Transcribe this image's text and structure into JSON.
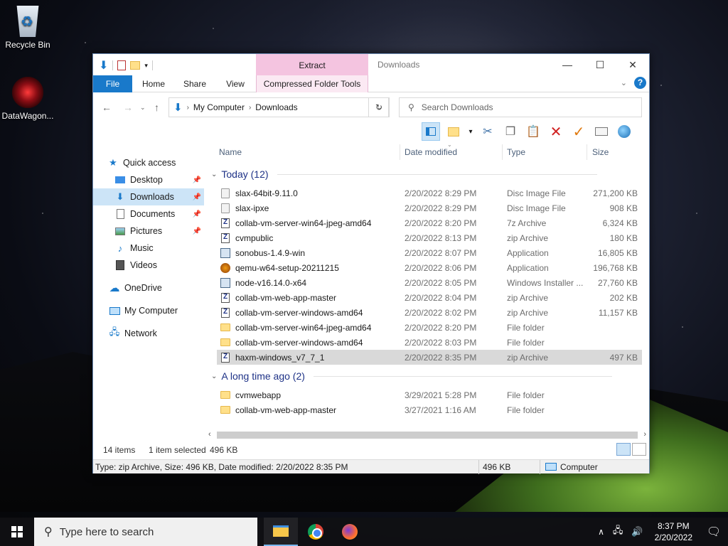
{
  "desktop": {
    "icons": [
      {
        "label": "Recycle Bin"
      },
      {
        "label": "DataWagon..."
      }
    ]
  },
  "window": {
    "title": "Downloads",
    "contextual_tab_group": "Extract",
    "ribbon_tabs": {
      "file": "File",
      "home": "Home",
      "share": "Share",
      "view": "View",
      "contextual": "Compressed Folder Tools"
    },
    "address": {
      "segments": [
        "My Computer",
        "Downloads"
      ]
    },
    "search": {
      "placeholder": "Search Downloads"
    },
    "nav_pane": [
      {
        "label": "Quick access",
        "icon": "star-icon"
      },
      {
        "label": "Desktop",
        "icon": "desktop-icon",
        "pinned": true
      },
      {
        "label": "Downloads",
        "icon": "download-arrow-icon",
        "pinned": true,
        "selected": true
      },
      {
        "label": "Documents",
        "icon": "document-icon",
        "pinned": true
      },
      {
        "label": "Pictures",
        "icon": "pictures-icon",
        "pinned": true
      },
      {
        "label": "Music",
        "icon": "music-icon"
      },
      {
        "label": "Videos",
        "icon": "videos-icon"
      },
      {
        "label": "OneDrive",
        "icon": "cloud-icon"
      },
      {
        "label": "My Computer",
        "icon": "computer-icon"
      },
      {
        "label": "Network",
        "icon": "network-icon"
      }
    ],
    "columns": {
      "name": "Name",
      "date": "Date modified",
      "type": "Type",
      "size": "Size"
    },
    "groups": [
      {
        "label": "Today (12)",
        "files": [
          {
            "name": "slax-64bit-9.11.0",
            "date": "2/20/2022 8:29 PM",
            "type": "Disc Image File",
            "size": "271,200 KB",
            "icon": "disc"
          },
          {
            "name": "slax-ipxe",
            "date": "2/20/2022 8:29 PM",
            "type": "Disc Image File",
            "size": "908 KB",
            "icon": "disc"
          },
          {
            "name": "collab-vm-server-win64-jpeg-amd64",
            "date": "2/20/2022 8:20 PM",
            "type": "7z Archive",
            "size": "6,324 KB",
            "icon": "zip"
          },
          {
            "name": "cvmpublic",
            "date": "2/20/2022 8:13 PM",
            "type": "zip Archive",
            "size": "180 KB",
            "icon": "zip"
          },
          {
            "name": "sonobus-1.4.9-win",
            "date": "2/20/2022 8:07 PM",
            "type": "Application",
            "size": "16,805 KB",
            "icon": "app"
          },
          {
            "name": "qemu-w64-setup-20211215",
            "date": "2/20/2022 8:06 PM",
            "type": "Application",
            "size": "196,768 KB",
            "icon": "qemu"
          },
          {
            "name": "node-v16.14.0-x64",
            "date": "2/20/2022 8:05 PM",
            "type": "Windows Installer ...",
            "size": "27,760 KB",
            "icon": "app"
          },
          {
            "name": "collab-vm-web-app-master",
            "date": "2/20/2022 8:04 PM",
            "type": "zip Archive",
            "size": "202 KB",
            "icon": "zip"
          },
          {
            "name": "collab-vm-server-windows-amd64",
            "date": "2/20/2022 8:02 PM",
            "type": "zip Archive",
            "size": "11,157 KB",
            "icon": "zip"
          },
          {
            "name": "collab-vm-server-win64-jpeg-amd64",
            "date": "2/20/2022 8:20 PM",
            "type": "File folder",
            "size": "",
            "icon": "folder"
          },
          {
            "name": "collab-vm-server-windows-amd64",
            "date": "2/20/2022 8:03 PM",
            "type": "File folder",
            "size": "",
            "icon": "folder"
          },
          {
            "name": "haxm-windows_v7_7_1",
            "date": "2/20/2022 8:35 PM",
            "type": "zip Archive",
            "size": "497 KB",
            "icon": "zip",
            "selected": true
          }
        ]
      },
      {
        "label": "A long time ago (2)",
        "files": [
          {
            "name": "cvmwebapp",
            "date": "3/29/2021 5:28 PM",
            "type": "File folder",
            "size": "",
            "icon": "folder"
          },
          {
            "name": "collab-vm-web-app-master",
            "date": "3/27/2021 1:16 AM",
            "type": "File folder",
            "size": "",
            "icon": "folder"
          }
        ]
      }
    ],
    "status": {
      "item_count": "14 items",
      "selection": "1 item selected",
      "selection_size": "496 KB",
      "details": "Type: zip Archive, Size: 496 KB, Date modified: 2/20/2022 8:35 PM",
      "size": "496 KB",
      "location": "Computer"
    }
  },
  "taskbar": {
    "search_placeholder": "Type here to search",
    "time": "8:37 PM",
    "date": "2/20/2022"
  }
}
